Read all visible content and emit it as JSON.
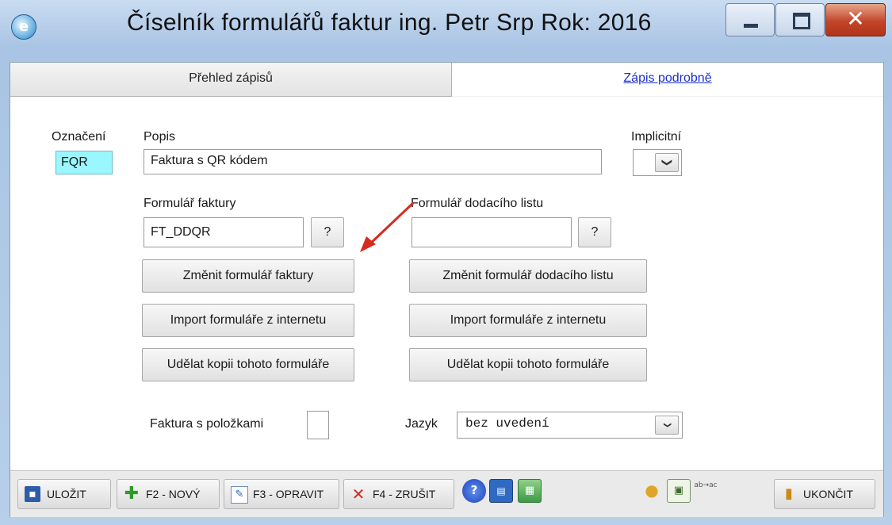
{
  "window": {
    "title": "Číselník formulářů faktur  ing. Petr Srp  Rok: 2016",
    "app_icon_glyph": "e",
    "minimize_icon": "minimize-icon",
    "maximize_icon": "maximize-icon",
    "close_glyph": "✕"
  },
  "tabs": [
    {
      "label": "Přehled zápisů",
      "active": false
    },
    {
      "label": "Zápis podrobně",
      "active": true
    }
  ],
  "form": {
    "oznaceni_label": "Označení",
    "oznaceni_value": "FQR",
    "popis_label": "Popis",
    "popis_value": "Faktura s QR kódem",
    "implicitni_label": "Implicitní",
    "implicitni_value": "",
    "formular_faktury_label": "Formulář faktury",
    "formular_faktury_value": "FT_DDQR",
    "formular_dl_label": "Formulář dodacího listu",
    "formular_dl_value": "",
    "help_label": "?",
    "zmenit_faktury": "Změnit formulář faktury",
    "zmenit_dl": "Změnit formulář dodacího listu",
    "import_label": "Import formuláře z internetu",
    "kopie_label": "Udělat kopii tohoto formuláře",
    "polozky_label": "Faktura s položkami",
    "polozky_checked": false,
    "jazyk_label": "Jazyk",
    "jazyk_value": "bez uvedení",
    "dropdown_glyph": "❯"
  },
  "toolbar": {
    "ulozit": "ULOŽIT",
    "novy": "F2 - NOVÝ",
    "opravit": "F3 - OPRAVIT",
    "zrusit": "F4 - ZRUŠIT",
    "ukoncit": "UKONČIT",
    "spellcheck_glyph": "ab→ac"
  },
  "colors": {
    "accent_link": "#1b2fd0",
    "code_field": "#9bf7ff",
    "arrow": "#d62b1f",
    "close_button": "#c3462a"
  }
}
